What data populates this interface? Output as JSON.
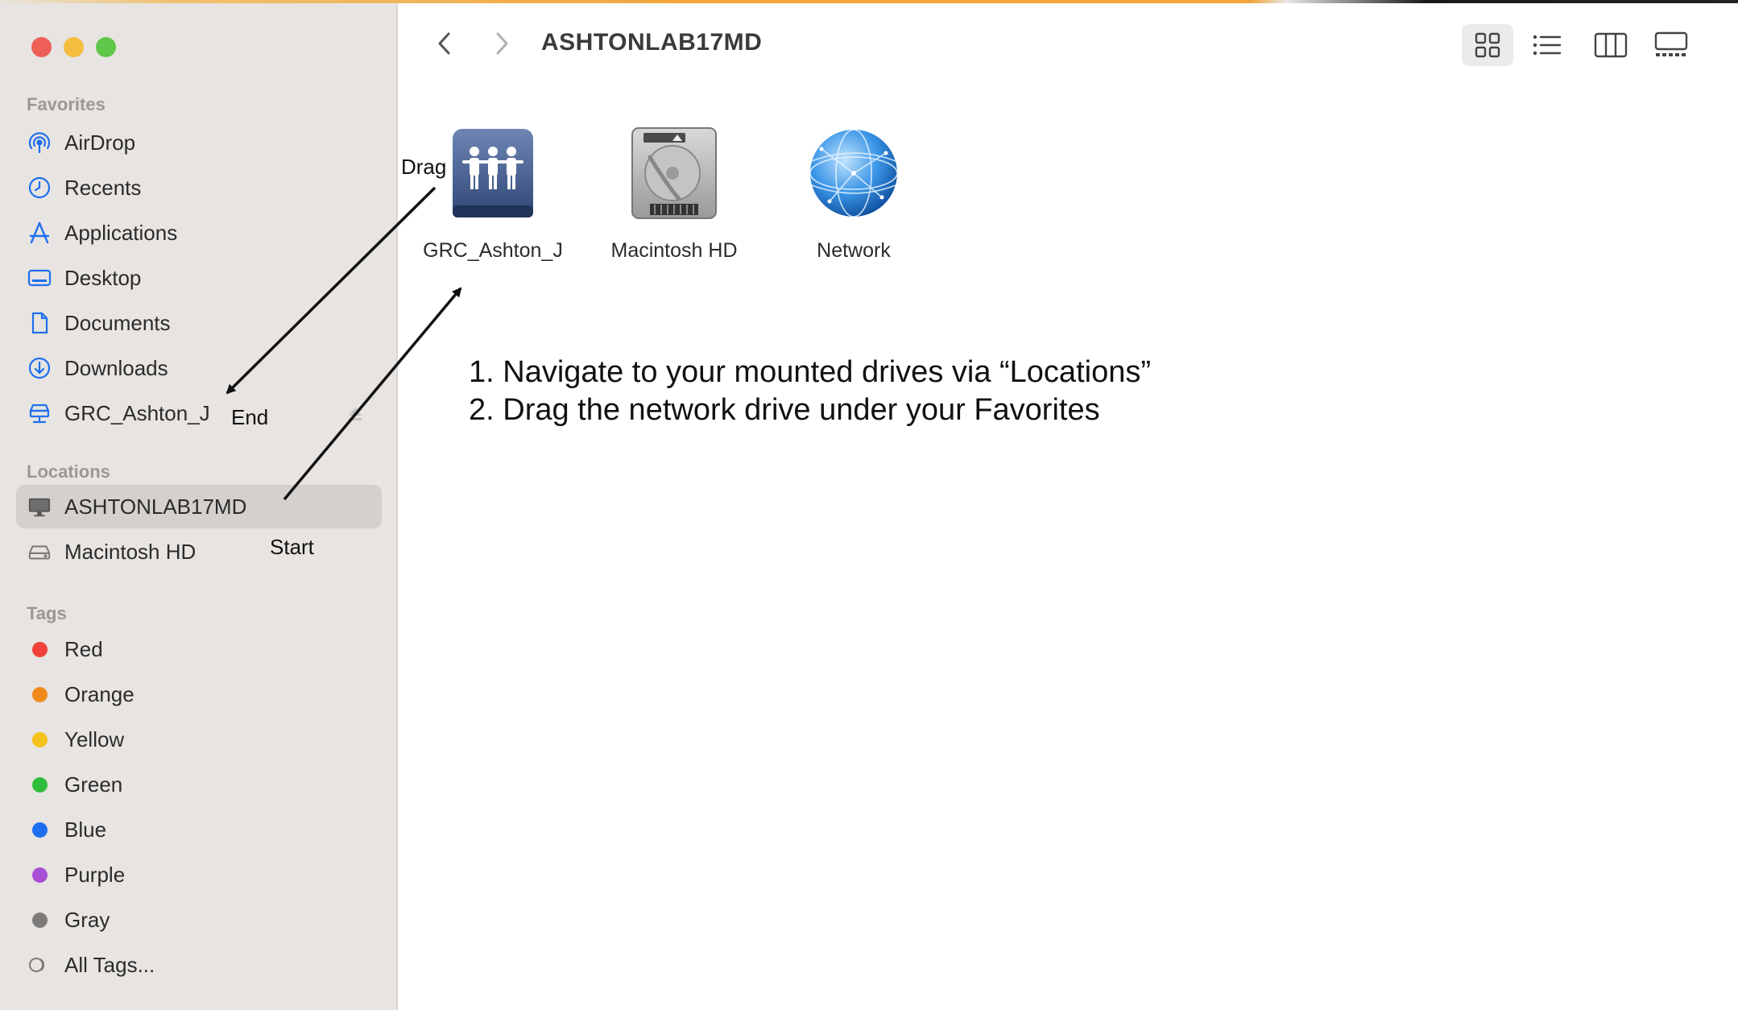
{
  "window": {
    "title": "ASHTONLAB17MD"
  },
  "sidebar": {
    "favorites_label": "Favorites",
    "favorites": [
      {
        "label": "AirDrop",
        "icon": "airdrop-icon"
      },
      {
        "label": "Recents",
        "icon": "clock-icon"
      },
      {
        "label": "Applications",
        "icon": "applications-icon"
      },
      {
        "label": "Desktop",
        "icon": "desktop-icon"
      },
      {
        "label": "Documents",
        "icon": "document-icon"
      },
      {
        "label": "Downloads",
        "icon": "download-icon"
      },
      {
        "label": "GRC_Ashton_J",
        "icon": "network-drive-icon"
      }
    ],
    "locations_label": "Locations",
    "locations": [
      {
        "label": "ASHTONLAB17MD",
        "icon": "computer-icon",
        "selected": true
      },
      {
        "label": "Macintosh HD",
        "icon": "hard-drive-icon"
      }
    ],
    "tags_label": "Tags",
    "tags": [
      {
        "label": "Red",
        "color": "#f0403a"
      },
      {
        "label": "Orange",
        "color": "#f08a1c"
      },
      {
        "label": "Yellow",
        "color": "#f5c21b"
      },
      {
        "label": "Green",
        "color": "#2fbe3b"
      },
      {
        "label": "Blue",
        "color": "#1e6ff0"
      },
      {
        "label": "Purple",
        "color": "#a84fd6"
      },
      {
        "label": "Gray",
        "color": "#7d7b7a"
      }
    ],
    "all_tags_label": "All Tags..."
  },
  "files": [
    {
      "label": "GRC_Ashton_J",
      "icon": "shared-network-volume-icon"
    },
    {
      "label": "Macintosh HD",
      "icon": "hard-drive-icon"
    },
    {
      "label": "Network",
      "icon": "globe-icon"
    }
  ],
  "instructions": {
    "line1": "1. Navigate to your mounted drives via  “Locations”",
    "line2": "2. Drag the network drive under your Favorites"
  },
  "annotations": {
    "drag": "Drag",
    "end": "End",
    "start": "Start"
  },
  "colors": {
    "close": "#ed5f57",
    "minimize": "#f5bd3e",
    "zoom": "#5fc74a",
    "accent": "#1e6ff0"
  }
}
